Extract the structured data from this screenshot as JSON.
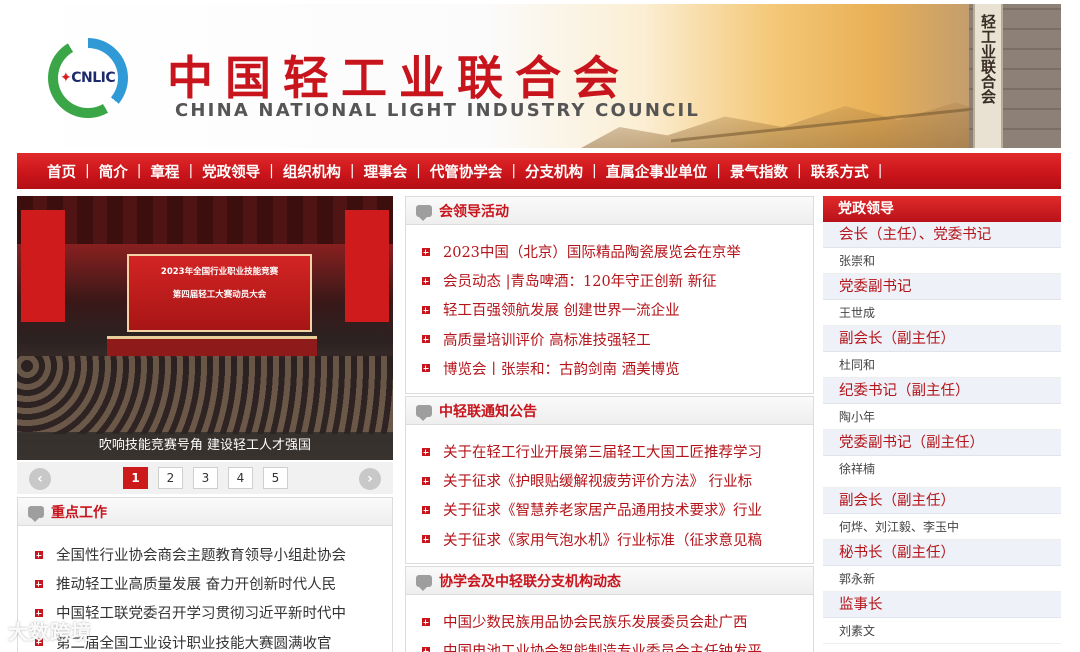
{
  "header": {
    "logo_text": "CNLIC",
    "cn_title": "中国轻工业联合会",
    "en_title": "CHINA NATIONAL LIGHT INDUSTRY COUNCIL",
    "stele_text": "轻工业联合会"
  },
  "nav": {
    "items": [
      "首页",
      "简介",
      "章程",
      "党政领导",
      "组织机构",
      "理事会",
      "代管协学会",
      "分支机构",
      "直属企事业单位",
      "景气指数",
      "联系方式"
    ],
    "separator": "|"
  },
  "slideshow": {
    "screen_line1": "2023年全国行业职业技能竞赛",
    "screen_line2": "第四届轻工大赛动员大会",
    "caption": "吹响技能竞赛号角 建设轻工人才强国",
    "prev": "‹",
    "next": "›",
    "pages": [
      "1",
      "2",
      "3",
      "4",
      "5"
    ],
    "active_page": "1"
  },
  "key_work": {
    "title": "重点工作",
    "items": [
      "全国性行业协会商会主题教育领导小组赴协会",
      "推动轻工业高质量发展 奋力开创新时代人民",
      "中国轻工联党委召开学习贯彻习近平新时代中",
      "第二届全国工业设计职业技能大赛圆满收官"
    ]
  },
  "activities": {
    "title": "会领导活动",
    "items": [
      "2023中国（北京）国际精品陶瓷展览会在京举",
      "会员动态 |青岛啤酒：120年守正创新 新征",
      "轻工百强领航发展 创建世界一流企业",
      "高质量培训评价 高标准技强轻工",
      "博览会丨张崇和：古韵剑南 酒美博览"
    ]
  },
  "notices": {
    "title": "中轻联通知公告",
    "items": [
      "关于在轻工行业开展第三届轻工大国工匠推荐学习",
      "关于征求《护眼贴缓解视疲劳评价方法》 行业标",
      "关于征求《智慧养老家居产品通用技术要求》行业",
      "关于征求《家用气泡水机》行业标准（征求意见稿"
    ]
  },
  "assoc": {
    "title": "协学会及中轻联分支机构动态",
    "items": [
      "中国少数民族用品协会民族乐发展委员会赴广西",
      "中国电池工业协会智能制造专业委员会主任钟发平"
    ]
  },
  "leaders": {
    "title": "党政领导",
    "groups": [
      {
        "role": "会长（主任）、党委书记",
        "names": "张崇和"
      },
      {
        "role": "党委副书记",
        "names": "王世成"
      },
      {
        "role": "副会长（副主任）",
        "names": "杜同和"
      },
      {
        "role": "纪委书记（副主任）",
        "names": "陶小年"
      },
      {
        "role": "党委副书记（副主任）",
        "names": "徐祥楠"
      },
      {
        "role": "副会长（副主任）",
        "names": "何烨、刘江毅、李玉中"
      },
      {
        "role": "秘书长（副主任）",
        "names": "郭永新"
      },
      {
        "role": "监事长",
        "names": "刘素文"
      }
    ]
  },
  "watermark": "大数跨境",
  "colors": {
    "brand_red": "#c8141c",
    "nav_red": "#d21f24",
    "role_bg": "#eef1f7"
  }
}
